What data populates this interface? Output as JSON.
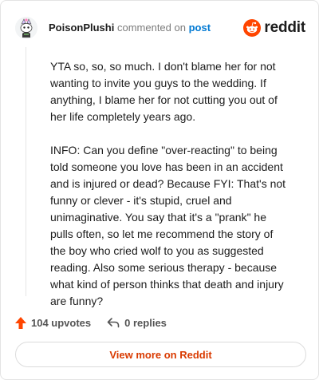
{
  "header": {
    "username": "PoisonPlushi",
    "action_text": "commented on",
    "post_link": "post",
    "brand": "reddit"
  },
  "comment": {
    "paragraphs": [
      "YTA so, so, so much. I don't blame her for not wanting to invite you guys to the wedding. If anything, I blame her for not cutting you out of her life completely years ago.",
      "INFO: Can you define \"over-reacting\" to being told someone you love has been in an accident and is injured or dead? Because FYI: That's not funny or clever - it's stupid, cruel and unimaginative. You say that it's a \"prank\" he pulls often, so let me recommend the story of the boy who cried wolf to you as suggested reading. Also some serious therapy - because what kind of person thinks that death and injury are funny?"
    ]
  },
  "footer": {
    "upvotes_label": "104 upvotes",
    "replies_label": "0 replies",
    "view_more_label": "View more on Reddit"
  },
  "colors": {
    "brand_orange": "#ff4500",
    "link_blue": "#0079d3",
    "view_more_text": "#d93a00"
  },
  "icons": {
    "avatar": "snoo-avatar",
    "upvote": "upvote-arrow-icon",
    "reply": "reply-arrow-icon",
    "logo": "reddit-snoo-icon"
  }
}
